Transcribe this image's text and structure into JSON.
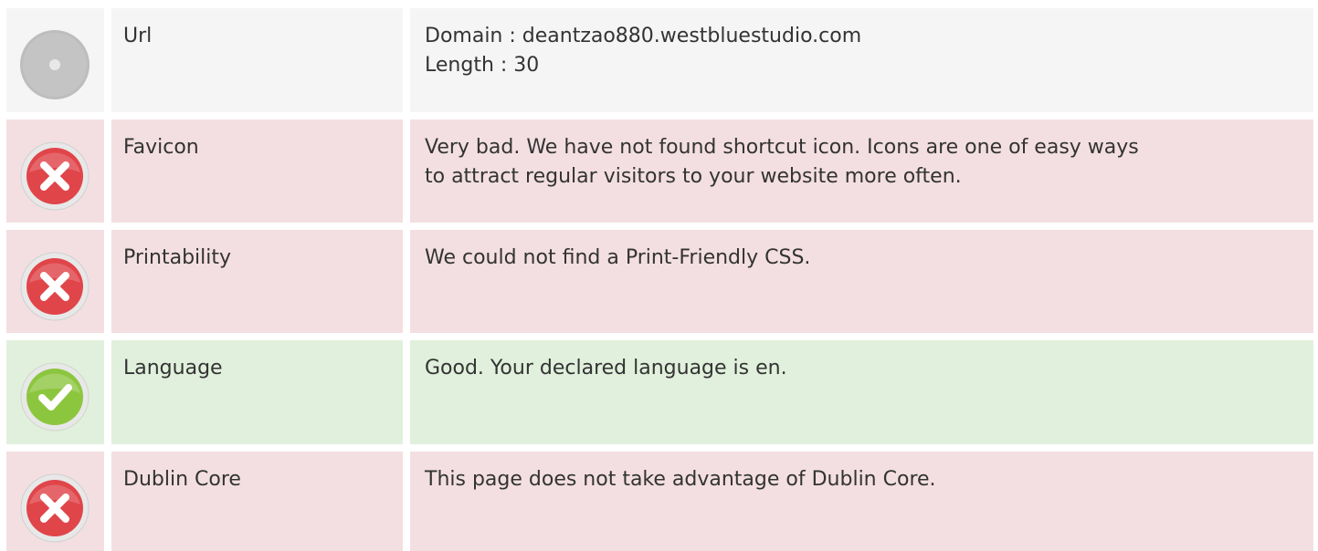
{
  "rows": [
    {
      "status": "neutral",
      "icon": "neutral-disc-icon",
      "label": "Url",
      "lines": [
        "Domain : deantzao880.westbluestudio.com",
        "Length : 30"
      ]
    },
    {
      "status": "bad",
      "icon": "error-x-icon",
      "label": "Favicon",
      "lines": [
        "Very bad. We have not found shortcut icon. Icons are one of easy ways",
        "to attract regular visitors to your website more often."
      ]
    },
    {
      "status": "bad",
      "icon": "error-x-icon",
      "label": "Printability",
      "lines": [
        "We could not find a Print-Friendly CSS."
      ]
    },
    {
      "status": "good",
      "icon": "check-mark-icon",
      "label": "Language",
      "lines": [
        "Good. Your declared language is en."
      ]
    },
    {
      "status": "bad",
      "icon": "error-x-icon",
      "label": "Dublin Core",
      "lines": [
        "This page does not take advantage of Dublin Core."
      ]
    }
  ],
  "colors": {
    "neutral_bg": "#f5f5f5",
    "bad_bg": "#f3dfe1",
    "good_bg": "#e0f0dc",
    "error_red": "#e0454a",
    "success_green": "#8cc63f",
    "neutral_gray": "#bdbdbd"
  }
}
